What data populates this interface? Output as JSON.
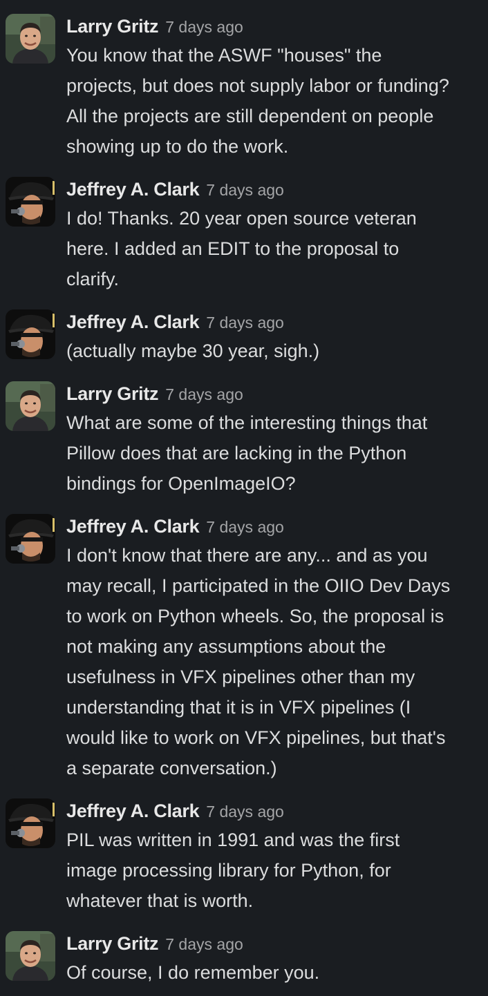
{
  "messages": [
    {
      "author": "Larry Gritz",
      "avatar_icon": "avatar-larry-icon",
      "timestamp": "7 days ago",
      "lines": [
        "You know that the ASWF \"houses\" the",
        "projects, but does not supply labor or funding?",
        "All the projects are still dependent on people",
        "showing up to do the work."
      ]
    },
    {
      "author": "Jeffrey A. Clark",
      "avatar_icon": "avatar-jeffrey-icon",
      "timestamp": "7 days ago",
      "lines": [
        "I do! Thanks. 20 year open source veteran",
        "here. I added an EDIT to the proposal to",
        "clarify."
      ]
    },
    {
      "author": "Jeffrey A. Clark",
      "avatar_icon": "avatar-jeffrey-icon",
      "timestamp": "7 days ago",
      "lines": [
        "(actually maybe 30 year, sigh.)"
      ]
    },
    {
      "author": "Larry Gritz",
      "avatar_icon": "avatar-larry-icon",
      "timestamp": "7 days ago",
      "lines": [
        "What are some of the interesting things that",
        "Pillow does that are lacking in the Python",
        "bindings for OpenImageIO?"
      ]
    },
    {
      "author": "Jeffrey A. Clark",
      "avatar_icon": "avatar-jeffrey-icon",
      "timestamp": "7 days ago",
      "lines": [
        "I don't know that there are any... and as you",
        "may recall, I participated in the OIIO Dev Days",
        "to work on Python wheels. So, the proposal is",
        "not making any assumptions about the",
        "usefulness in VFX pipelines other than my",
        "understanding that it is in VFX pipelines (I",
        "would like to work on VFX pipelines, but that's",
        "a separate conversation.)"
      ]
    },
    {
      "author": "Jeffrey A. Clark",
      "avatar_icon": "avatar-jeffrey-icon",
      "timestamp": "7 days ago",
      "lines": [
        "PIL was written in 1991 and was the first",
        "image processing library for Python, for",
        "whatever that is worth."
      ]
    },
    {
      "author": "Larry Gritz",
      "avatar_icon": "avatar-larry-icon",
      "timestamp": "7 days ago",
      "lines": [
        "Of course, I do remember you."
      ]
    }
  ],
  "colors": {
    "background": "#1a1d21",
    "author": "#e8e8e8",
    "timestamp": "#a4a5a7",
    "body_text": "#dcddde"
  }
}
